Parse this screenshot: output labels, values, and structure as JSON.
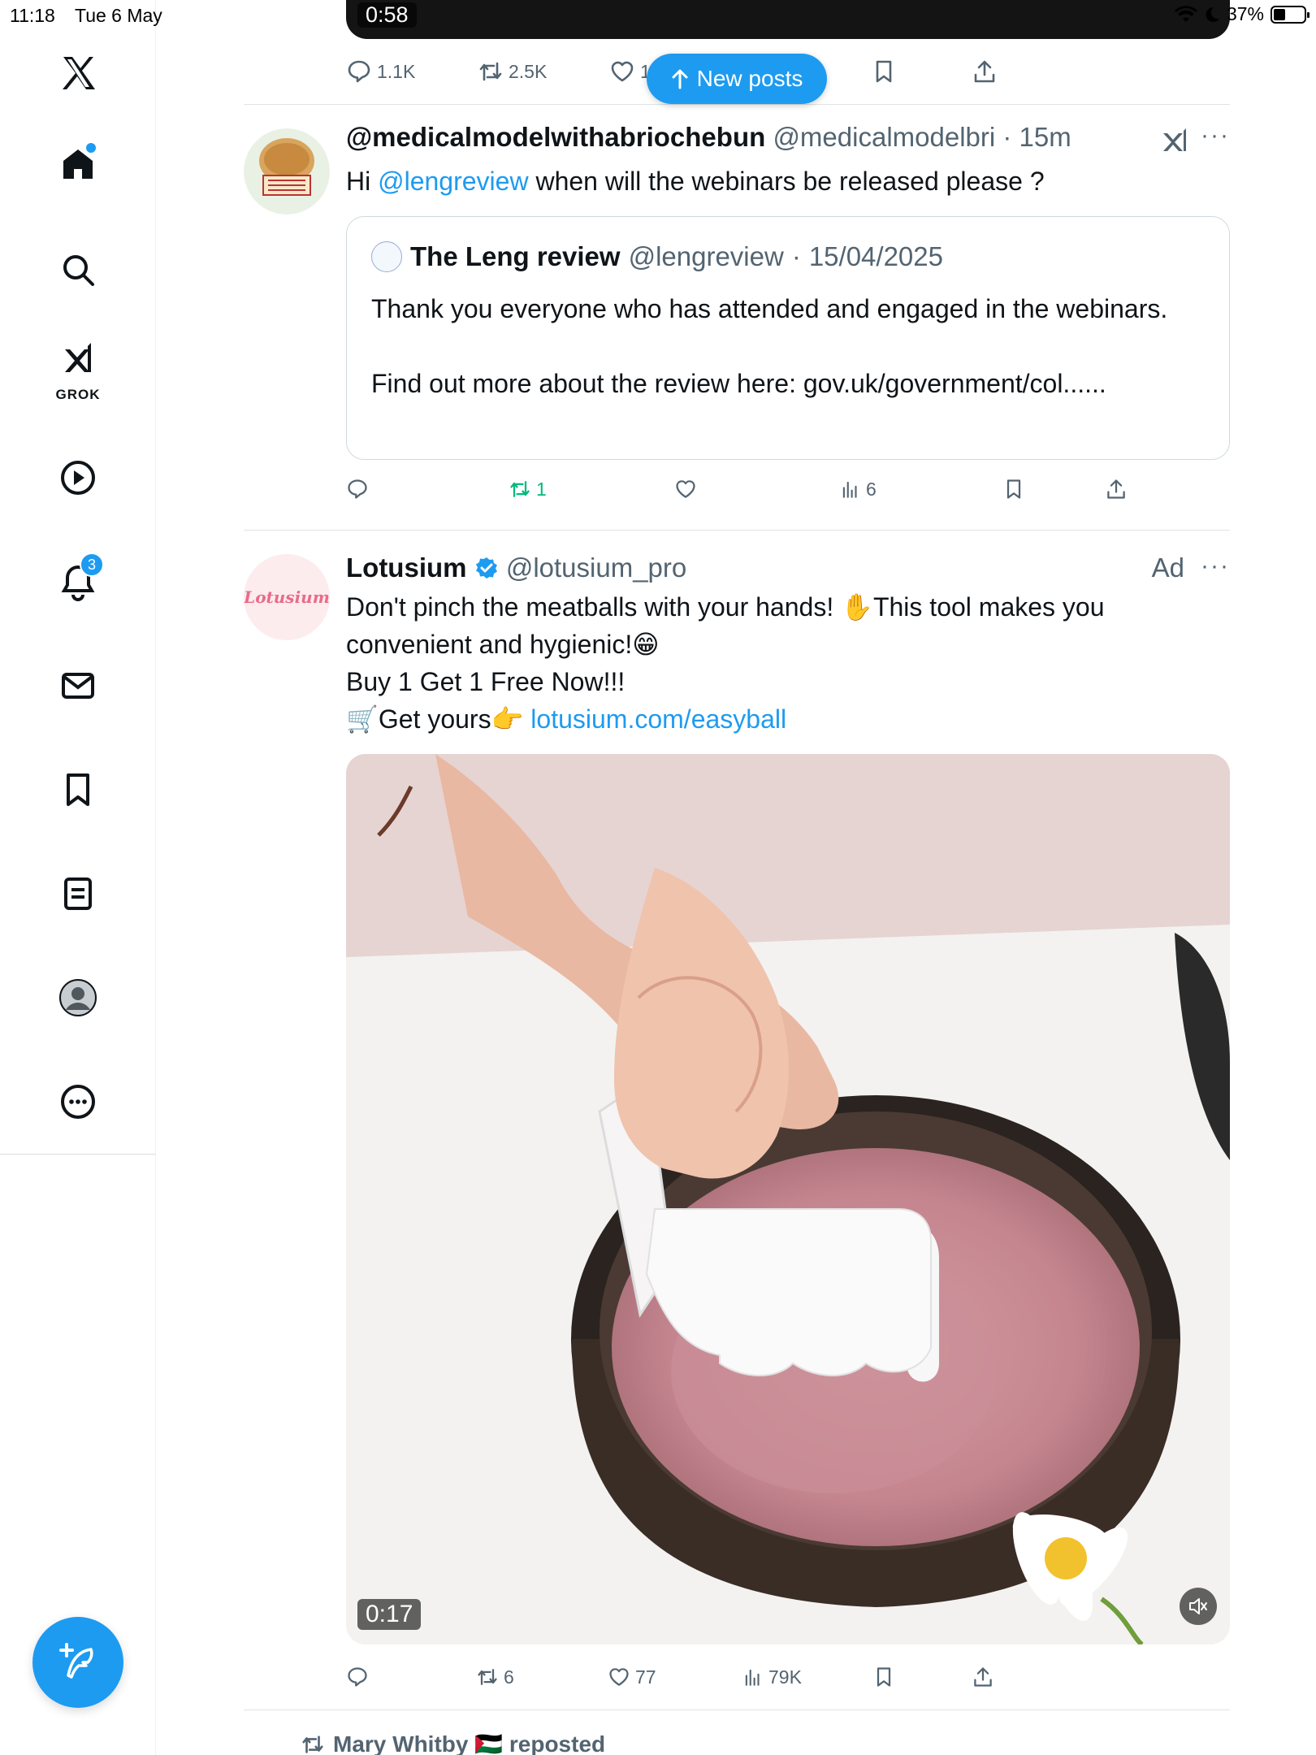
{
  "status_bar": {
    "time": "11:18",
    "date": "Tue 6 May",
    "battery": "37%"
  },
  "sidebar": {
    "grok_label": "GROK",
    "notifications_count": "3"
  },
  "top_post": {
    "video_duration": "0:58",
    "replies": "1.1K",
    "reposts": "2.5K",
    "likes": "1"
  },
  "new_posts_label": "New posts",
  "reply_post": {
    "display_name": "@medicalmodelwithabriochebun",
    "handle": "@medicalmodelbri",
    "time": "15m",
    "text_prefix": "Hi ",
    "mention": "@lengreview",
    "text_suffix": " when will the webinars be released please ?",
    "reposts": "1",
    "views": "6",
    "quote": {
      "name": "The Leng review",
      "handle": "@lengreview",
      "date": "15/04/2025",
      "text": "Thank you everyone who has attended and engaged in the webinars.\n\nFind out more about the review here: gov.uk/government/col......"
    }
  },
  "ad_post": {
    "display_name": "Lotusium",
    "handle": "@lotusium_pro",
    "ad_label": "Ad",
    "avatar_text": "Lotusium",
    "line1": "Don't pinch the meatballs with your hands! ✋This tool makes you convenient and hygienic!😁",
    "line2": "Buy 1 Get 1 Free Now!!!",
    "line3": "🛒Get yours👉 ",
    "link": "lotusium.com/easyball",
    "video_duration": "0:17",
    "reposts": "6",
    "likes": "77",
    "views": "79K"
  },
  "next_post": {
    "repost_text": "Mary Whitby 🇵🇸 reposted"
  }
}
